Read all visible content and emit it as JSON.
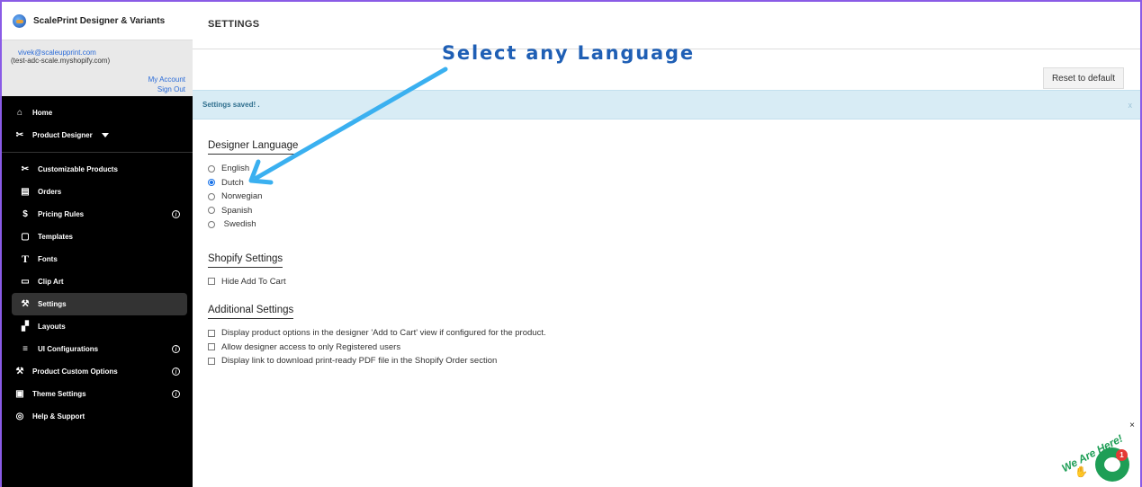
{
  "app": {
    "name": "ScalePrint Designer & Variants"
  },
  "account": {
    "email": "vivek@scaleupprint.com",
    "store": "(test-adc-scale.myshopify.com)",
    "my_account": "My Account",
    "sign_out": "Sign Out"
  },
  "nav": {
    "home": "Home",
    "product_designer": "Product Designer",
    "customizable_products": "Customizable Products",
    "orders": "Orders",
    "pricing_rules": "Pricing Rules",
    "templates": "Templates",
    "fonts": "Fonts",
    "clip_art": "Clip Art",
    "settings": "Settings",
    "layouts": "Layouts",
    "ui_configurations": "UI Configurations",
    "product_custom_options": "Product Custom Options",
    "theme_settings": "Theme Settings",
    "help_support": "Help & Support",
    "info_glyph": "i"
  },
  "header": {
    "title": "SETTINGS",
    "reset_label": "Reset to default"
  },
  "alert": {
    "message": "Settings saved! .",
    "close": "x"
  },
  "designer_language": {
    "title": "Designer Language",
    "options": [
      "English",
      "Dutch",
      "Norwegian",
      "Spanish",
      " Swedish"
    ],
    "selected": "Dutch"
  },
  "shopify_settings": {
    "title": "Shopify Settings",
    "hide_add_to_cart": "Hide Add To Cart"
  },
  "additional_settings": {
    "title": "Additional Settings",
    "options": [
      "Display product options in the designer 'Add to Cart' view if configured for the product.",
      "Allow designer access to only Registered users",
      "Display link to download print-ready PDF file in the Shopify Order section"
    ]
  },
  "annotation": {
    "text": "Select any Language",
    "color": "#1f5fb5",
    "arrow_color": "#3ab0f0"
  },
  "chat": {
    "label": "We Are Here!",
    "badge": "1",
    "close": "×"
  }
}
